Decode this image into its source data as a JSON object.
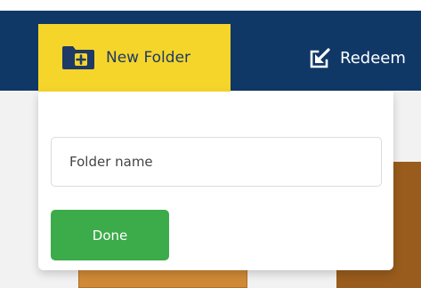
{
  "nav": {
    "new_folder_label": "New Folder",
    "new_folder_icon": "folder-plus-icon",
    "redeem_label": "Redeem",
    "redeem_icon": "redeem-icon"
  },
  "new_folder_popup": {
    "input_placeholder": "Folder name",
    "input_value": "",
    "done_label": "Done"
  },
  "colors": {
    "navbar": "#0f3867",
    "active_tab": "#f5d52a",
    "done_button": "#3cab4a"
  }
}
